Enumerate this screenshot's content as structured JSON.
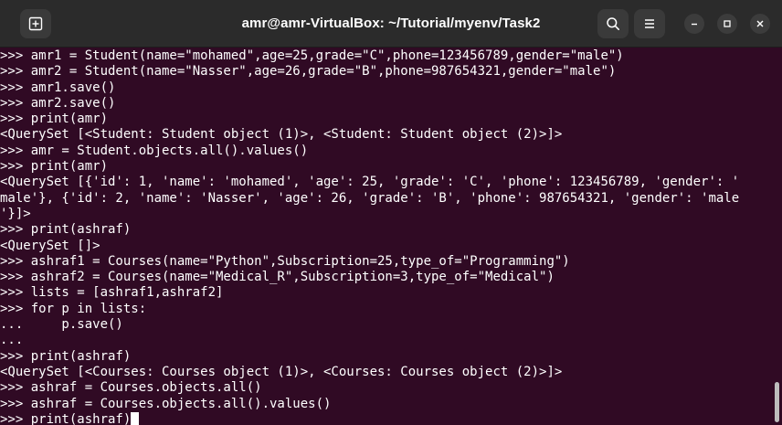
{
  "window": {
    "title": "amr@amr-VirtualBox: ~/Tutorial/myenv/Task2"
  },
  "icons": {
    "new_tab": "new-tab-icon",
    "search": "search-icon",
    "menu": "hamburger-menu-icon",
    "minimize": "minimize-icon",
    "maximize": "maximize-icon",
    "close": "close-icon"
  },
  "colors": {
    "terminal_background": "#300a24",
    "titlebar_background": "#2b2b2b",
    "text": "#ffffff"
  },
  "terminal": {
    "lines": [
      ">>> amr1 = Student(name=\"mohamed\",age=25,grade=\"C\",phone=123456789,gender=\"male\")",
      ">>> amr2 = Student(name=\"Nasser\",age=26,grade=\"B\",phone=987654321,gender=\"male\")",
      ">>> amr1.save()",
      ">>> amr2.save()",
      ">>> print(amr)",
      "<QuerySet [<Student: Student object (1)>, <Student: Student object (2)>]>",
      ">>> amr = Student.objects.all().values()",
      ">>> print(amr)",
      "<QuerySet [{'id': 1, 'name': 'mohamed', 'age': 25, 'grade': 'C', 'phone': 123456789, 'gender': '",
      "male'}, {'id': 2, 'name': 'Nasser', 'age': 26, 'grade': 'B', 'phone': 987654321, 'gender': 'male",
      "'}]>",
      ">>> print(ashraf)",
      "<QuerySet []>",
      ">>> ashraf1 = Courses(name=\"Python\",Subscription=25,type_of=\"Programming\")",
      ">>> ashraf2 = Courses(name=\"Medical_R\",Subscription=3,type_of=\"Medical\")",
      ">>> lists = [ashraf1,ashraf2]",
      ">>> for p in lists:",
      "...     p.save()",
      "...",
      ">>> print(ashraf)",
      "<QuerySet [<Courses: Courses object (1)>, <Courses: Courses object (2)>]>",
      ">>> ashraf = Courses.objects.all()",
      ">>> ashraf = Courses.objects.all().values()",
      ">>> print(ashraf)"
    ]
  }
}
